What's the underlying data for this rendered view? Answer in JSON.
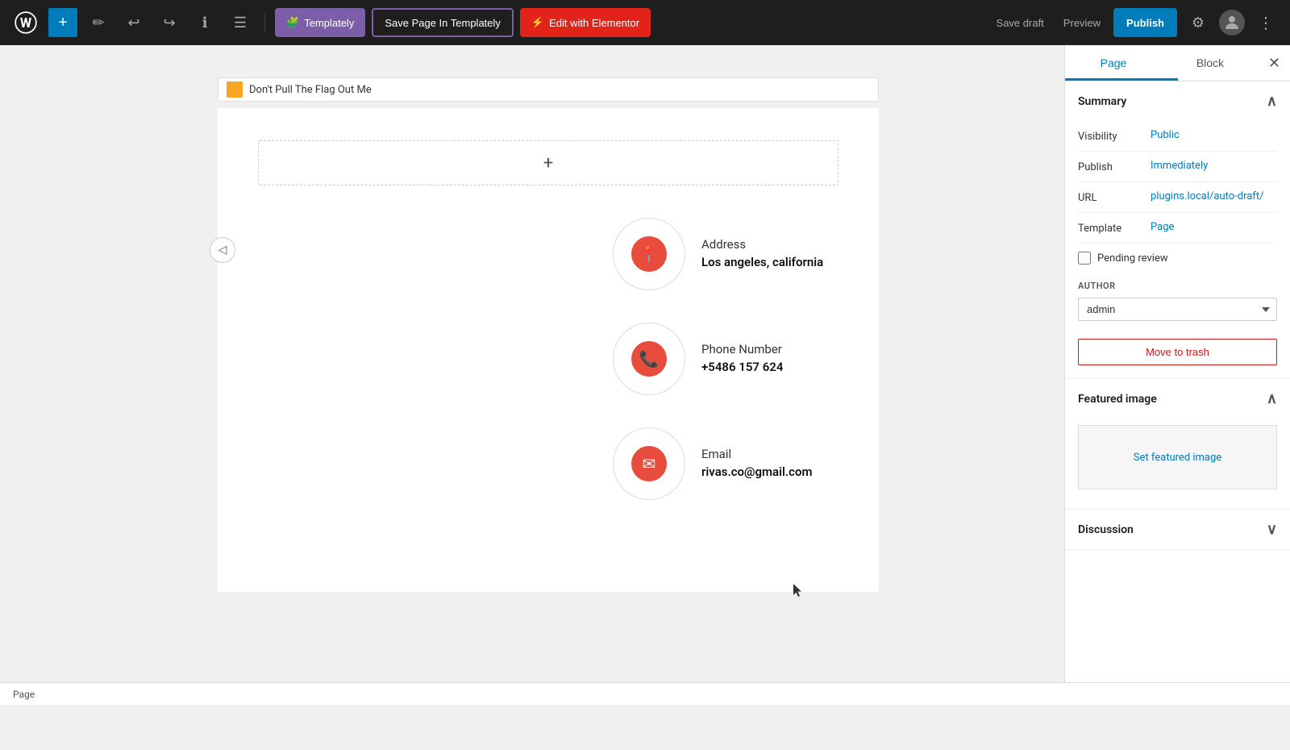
{
  "toolbar": {
    "add_label": "+",
    "templately_label": "Templately",
    "save_templately_label": "Save Page In Templately",
    "elementor_label": "Edit with Elementor",
    "save_draft_label": "Save draft",
    "preview_label": "Preview",
    "publish_label": "Publish",
    "more_label": "⋮"
  },
  "sidebar": {
    "tab_page": "Page",
    "tab_block": "Block",
    "close_label": "✕",
    "summary": {
      "title": "Summary",
      "visibility_label": "Visibility",
      "visibility_value": "Public",
      "publish_label": "Publish",
      "publish_value": "Immediately",
      "url_label": "URL",
      "url_value": "plugins.local/auto-draft/",
      "template_label": "Template",
      "template_value": "Page",
      "pending_review": "Pending review"
    },
    "author": {
      "label": "AUTHOR",
      "value": "admin"
    },
    "move_trash": "Move to trash",
    "featured_image": {
      "title": "Featured image",
      "set_label": "Set featured image"
    },
    "discussion": {
      "title": "Discussion"
    }
  },
  "content": {
    "page_title": "Don't Pull The Flag Out Me",
    "address": {
      "label": "Address",
      "value": "Los angeles, california"
    },
    "phone": {
      "label": "Phone Number",
      "value": "+5486 157 624"
    },
    "email": {
      "label": "Email",
      "value": "rivas.co@gmail.com"
    }
  },
  "status_bar": {
    "label": "Page"
  }
}
